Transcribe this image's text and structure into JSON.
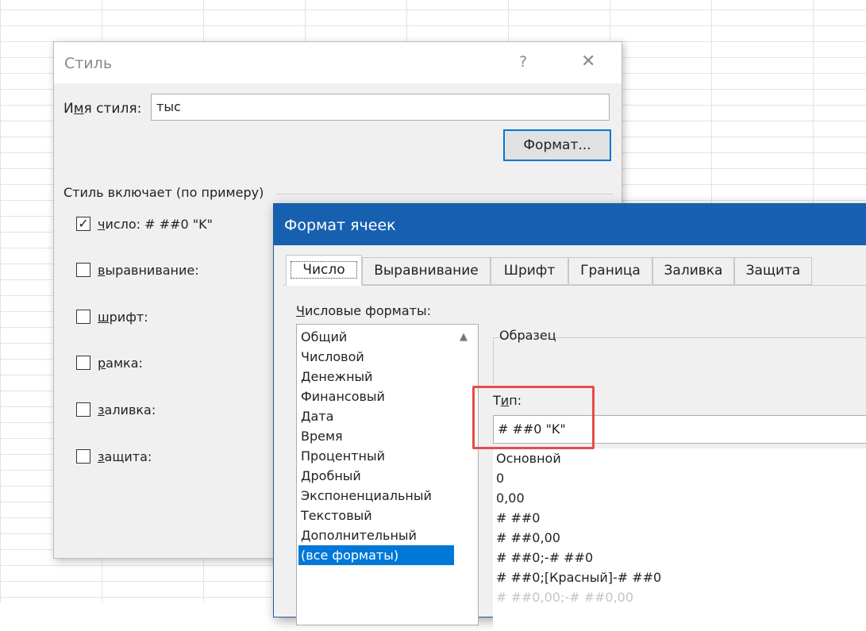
{
  "style_dialog": {
    "title": "Стиль",
    "help_icon": "?",
    "close_icon": "✕",
    "name_label_pre": "И",
    "name_label_ul": "м",
    "name_label_post": "я стиля:",
    "name_value": "тыс",
    "format_button": "Формат...",
    "includes_header": "Стиль включает (по примеру)",
    "checkboxes": [
      {
        "label_ul": "ч",
        "label_rest": "исло: # ##0 \"K\"",
        "checked": true
      },
      {
        "label_ul": "в",
        "label_rest": "ыравнивание:",
        "checked": false
      },
      {
        "label_ul": "ш",
        "label_rest": "рифт:",
        "checked": false
      },
      {
        "label_ul": "р",
        "label_rest": "амка:",
        "checked": false
      },
      {
        "label_ul": "з",
        "label_rest": "аливка:",
        "checked": false
      },
      {
        "label_ul": "з",
        "label_rest": "ащита:",
        "checked": false
      }
    ]
  },
  "format_dialog": {
    "title": "Формат ячеек",
    "tabs": [
      "Число",
      "Выравнивание",
      "Шрифт",
      "Граница",
      "Заливка",
      "Защита"
    ],
    "formats_label_ul": "Ч",
    "formats_label_rest": "исловые форматы:",
    "formats": [
      "Общий",
      "Числовой",
      "Денежный",
      "Финансовый",
      "Дата",
      "Время",
      "Процентный",
      "Дробный",
      "Экспоненциальный",
      "Текстовый",
      "Дополнительный",
      "(все форматы)"
    ],
    "selected_format": "(все форматы)",
    "sample_label": "Образец",
    "type_label_pre": "Т",
    "type_label_ul": "и",
    "type_label_post": "п:",
    "type_value": "# ##0 \"K\"",
    "type_list": [
      "Основной",
      "0",
      "0,00",
      "# ##0",
      "# ##0,00",
      "# ##0;-# ##0",
      "# ##0;[Красный]-# ##0",
      "# ##0,00;-# ##0,00"
    ]
  },
  "colors": {
    "titlebar_blue": "#1760b0",
    "selection_blue": "#0078d7",
    "highlight_red": "#e84b4b"
  }
}
